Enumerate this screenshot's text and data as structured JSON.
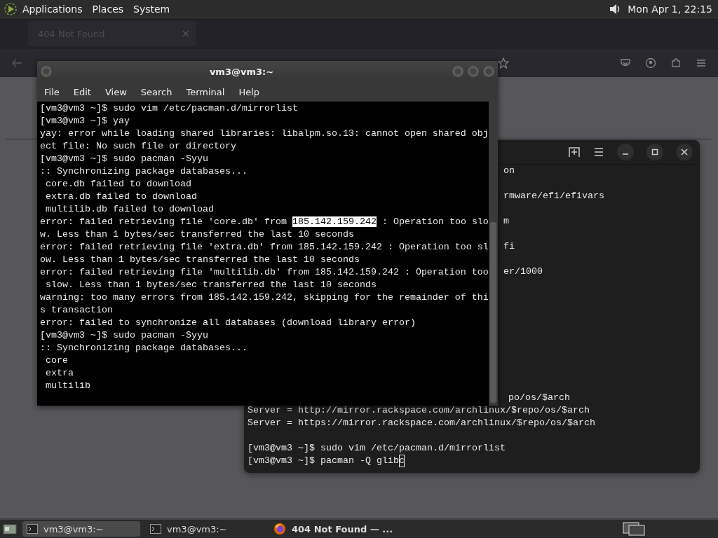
{
  "top_panel": {
    "menus": [
      "Applications",
      "Places",
      "System"
    ],
    "clock": "Mon Apr 1, 22:15"
  },
  "browser": {
    "tab_title": "404 Not Found"
  },
  "terminal": {
    "title": "vm3@vm3:~",
    "menu": [
      "File",
      "Edit",
      "View",
      "Search",
      "Terminal",
      "Help"
    ],
    "lines": [
      {
        "parts": [
          {
            "text": "[vm3@vm3 ~]$ sudo vim /etc/pacman.d/mirrorlist",
            "selected": false
          }
        ]
      },
      {
        "parts": [
          {
            "text": "[vm3@vm3 ~]$ yay",
            "selected": false
          }
        ]
      },
      {
        "parts": [
          {
            "text": "yay: error while loading shared libraries: libalpm.so.13: cannot open shared obj",
            "selected": false
          }
        ]
      },
      {
        "parts": [
          {
            "text": "ect file: No such file or directory",
            "selected": false
          }
        ]
      },
      {
        "parts": [
          {
            "text": "[vm3@vm3 ~]$ sudo pacman -Syyu",
            "selected": false
          }
        ]
      },
      {
        "parts": [
          {
            "text": ":: Synchronizing package databases...",
            "selected": false
          }
        ]
      },
      {
        "parts": [
          {
            "text": " core.db failed to download",
            "selected": false
          }
        ]
      },
      {
        "parts": [
          {
            "text": " extra.db failed to download",
            "selected": false
          }
        ]
      },
      {
        "parts": [
          {
            "text": " multilib.db failed to download",
            "selected": false
          }
        ]
      },
      {
        "parts": [
          {
            "text": "error: failed retrieving file 'core.db' from ",
            "selected": false
          },
          {
            "text": "185.142.159.242",
            "selected": true
          },
          {
            "text": " : Operation too slo",
            "selected": false
          }
        ]
      },
      {
        "parts": [
          {
            "text": "w. Less than 1 bytes/sec transferred the last 10 seconds",
            "selected": false
          }
        ]
      },
      {
        "parts": [
          {
            "text": "error: failed retrieving file 'extra.db' from 185.142.159.242 : Operation too sl",
            "selected": false
          }
        ]
      },
      {
        "parts": [
          {
            "text": "ow. Less than 1 bytes/sec transferred the last 10 seconds",
            "selected": false
          }
        ]
      },
      {
        "parts": [
          {
            "text": "error: failed retrieving file 'multilib.db' from 185.142.159.242 : Operation too",
            "selected": false
          }
        ]
      },
      {
        "parts": [
          {
            "text": " slow. Less than 1 bytes/sec transferred the last 10 seconds",
            "selected": false
          }
        ]
      },
      {
        "parts": [
          {
            "text": "warning: too many errors from 185.142.159.242, skipping for the remainder of thi",
            "selected": false
          }
        ]
      },
      {
        "parts": [
          {
            "text": "s transaction",
            "selected": false
          }
        ]
      },
      {
        "parts": [
          {
            "text": "error: failed to synchronize all databases (download library error)",
            "selected": false
          }
        ]
      },
      {
        "parts": [
          {
            "text": "[vm3@vm3 ~]$ sudo pacman -Syyu",
            "selected": false
          }
        ]
      },
      {
        "parts": [
          {
            "text": ":: Synchronizing package databases...",
            "selected": false
          }
        ]
      },
      {
        "parts": [
          {
            "text": " core",
            "selected": false
          }
        ]
      },
      {
        "parts": [
          {
            "text": " extra",
            "selected": false
          }
        ]
      },
      {
        "parts": [
          {
            "text": " multilib",
            "selected": false
          }
        ]
      }
    ]
  },
  "console": {
    "top_fragments": [
      "on",
      "rmware/efi/efivars",
      "m",
      "fi",
      "er/1000"
    ],
    "bottom_fragment": "po/os/$arch",
    "lines": [
      "Server = http://mirror.rackspace.com/archlinux/$repo/os/$arch",
      "Server = https://mirror.rackspace.com/archlinux/$repo/os/$arch"
    ],
    "prompt_lines": [
      "[vm3@vm3 ~]$ sudo vim /etc/pacman.d/mirrorlist",
      "[vm3@vm3 ~]$ pacman -Q glib"
    ],
    "cursor_char": "c"
  },
  "taskbar": {
    "tasks": [
      {
        "label": "vm3@vm3:~",
        "kind": "terminal",
        "selected": true
      },
      {
        "label": "vm3@vm3:~",
        "kind": "terminal",
        "selected": false
      },
      {
        "label": "404 Not Found — ...",
        "kind": "browser",
        "selected": false
      }
    ]
  }
}
